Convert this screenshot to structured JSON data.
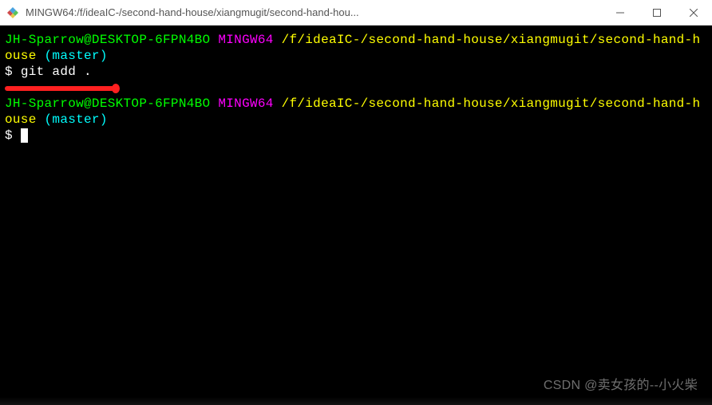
{
  "titlebar": {
    "title": "MINGW64:/f/ideaIC-/second-hand-house/xiangmugit/second-hand-hou..."
  },
  "terminal": {
    "prompt1": {
      "user_host": "JH-Sparrow@DESKTOP-6FPN4BO",
      "shell": "MINGW64",
      "path": "/f/ideaIC-/second-hand-house/xiangmugit/second-hand-house",
      "branch": "(master)",
      "symbol": "$",
      "command": "git add ."
    },
    "prompt2": {
      "user_host": "JH-Sparrow@DESKTOP-6FPN4BO",
      "shell": "MINGW64",
      "path": "/f/ideaIC-/second-hand-house/xiangmugit/second-hand-house",
      "branch": "(master)",
      "symbol": "$"
    }
  },
  "watermark": "CSDN @卖女孩的--小火柴"
}
